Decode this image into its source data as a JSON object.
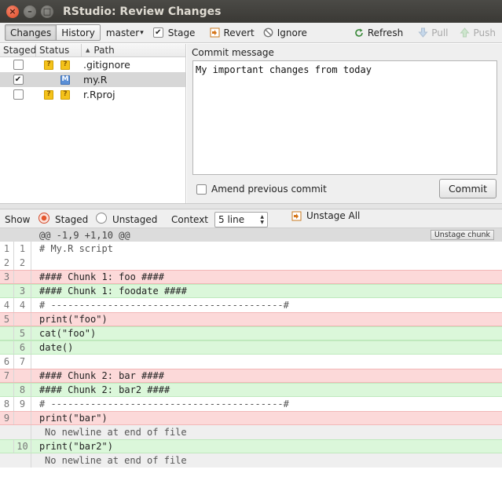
{
  "window": {
    "title": "RStudio: Review Changes",
    "close": "×",
    "minimize": "–",
    "maximize": "□"
  },
  "toolbar": {
    "changes_label": "Changes",
    "history_label": "History",
    "branch": "master",
    "branch_arrow": "▾",
    "stage_label": "Stage",
    "revert_label": "Revert",
    "ignore_label": "Ignore",
    "refresh_label": "Refresh",
    "pull_label": "Pull",
    "push_label": "Push"
  },
  "files": {
    "headers": {
      "staged": "Staged",
      "status": "Status",
      "path": "Path",
      "sort_arrow": "▲"
    },
    "rows": [
      {
        "staged": "",
        "badges": [
          "?",
          "?"
        ],
        "path": ".gitignore"
      },
      {
        "staged": "✔",
        "badges": [
          "M"
        ],
        "path": "my.R"
      },
      {
        "staged": "",
        "badges": [
          "?",
          "?"
        ],
        "path": "r.Rproj"
      }
    ]
  },
  "commit": {
    "label": "Commit message",
    "message": "My important changes from today",
    "amend_label": "Amend previous commit",
    "button_label": "Commit"
  },
  "showbar": {
    "show_label": "Show",
    "staged_label": "Staged",
    "unstaged_label": "Unstaged",
    "context_label": "Context",
    "context_value": "5 line",
    "unstage_all_label": "Unstage All"
  },
  "diff": {
    "hunk_header": "@@ -1,9 +1,10 @@",
    "unstage_chunk_label": "Unstage chunk",
    "lines": [
      {
        "type": "ctx",
        "old": "1",
        "new": "1",
        "text": "# My.R script"
      },
      {
        "type": "ctx",
        "old": "2",
        "new": "2",
        "text": ""
      },
      {
        "type": "del",
        "old": "3",
        "new": "",
        "text": "#### Chunk 1: foo ####"
      },
      {
        "type": "add",
        "old": "",
        "new": "3",
        "text": "#### Chunk 1: foodate ####"
      },
      {
        "type": "ctx",
        "old": "4",
        "new": "4",
        "text": "# -----------------------------------------#"
      },
      {
        "type": "del",
        "old": "5",
        "new": "",
        "text": "print(\"foo\")"
      },
      {
        "type": "add",
        "old": "",
        "new": "5",
        "text": "cat(\"foo\")"
      },
      {
        "type": "add",
        "old": "",
        "new": "6",
        "text": "date()"
      },
      {
        "type": "ctx",
        "old": "6",
        "new": "7",
        "text": ""
      },
      {
        "type": "del",
        "old": "7",
        "new": "",
        "text": "#### Chunk 2: bar ####"
      },
      {
        "type": "add",
        "old": "",
        "new": "8",
        "text": "#### Chunk 2: bar2 ####"
      },
      {
        "type": "ctx",
        "old": "8",
        "new": "9",
        "text": "# -----------------------------------------#"
      },
      {
        "type": "del",
        "old": "9",
        "new": "",
        "text": "print(\"bar\")"
      },
      {
        "type": "note",
        "old": "",
        "new": "",
        "text": "No newline at end of file"
      },
      {
        "type": "add",
        "old": "",
        "new": "10",
        "text": "print(\"bar2\")"
      },
      {
        "type": "note",
        "old": "",
        "new": "",
        "text": "No newline at end of file"
      }
    ]
  }
}
